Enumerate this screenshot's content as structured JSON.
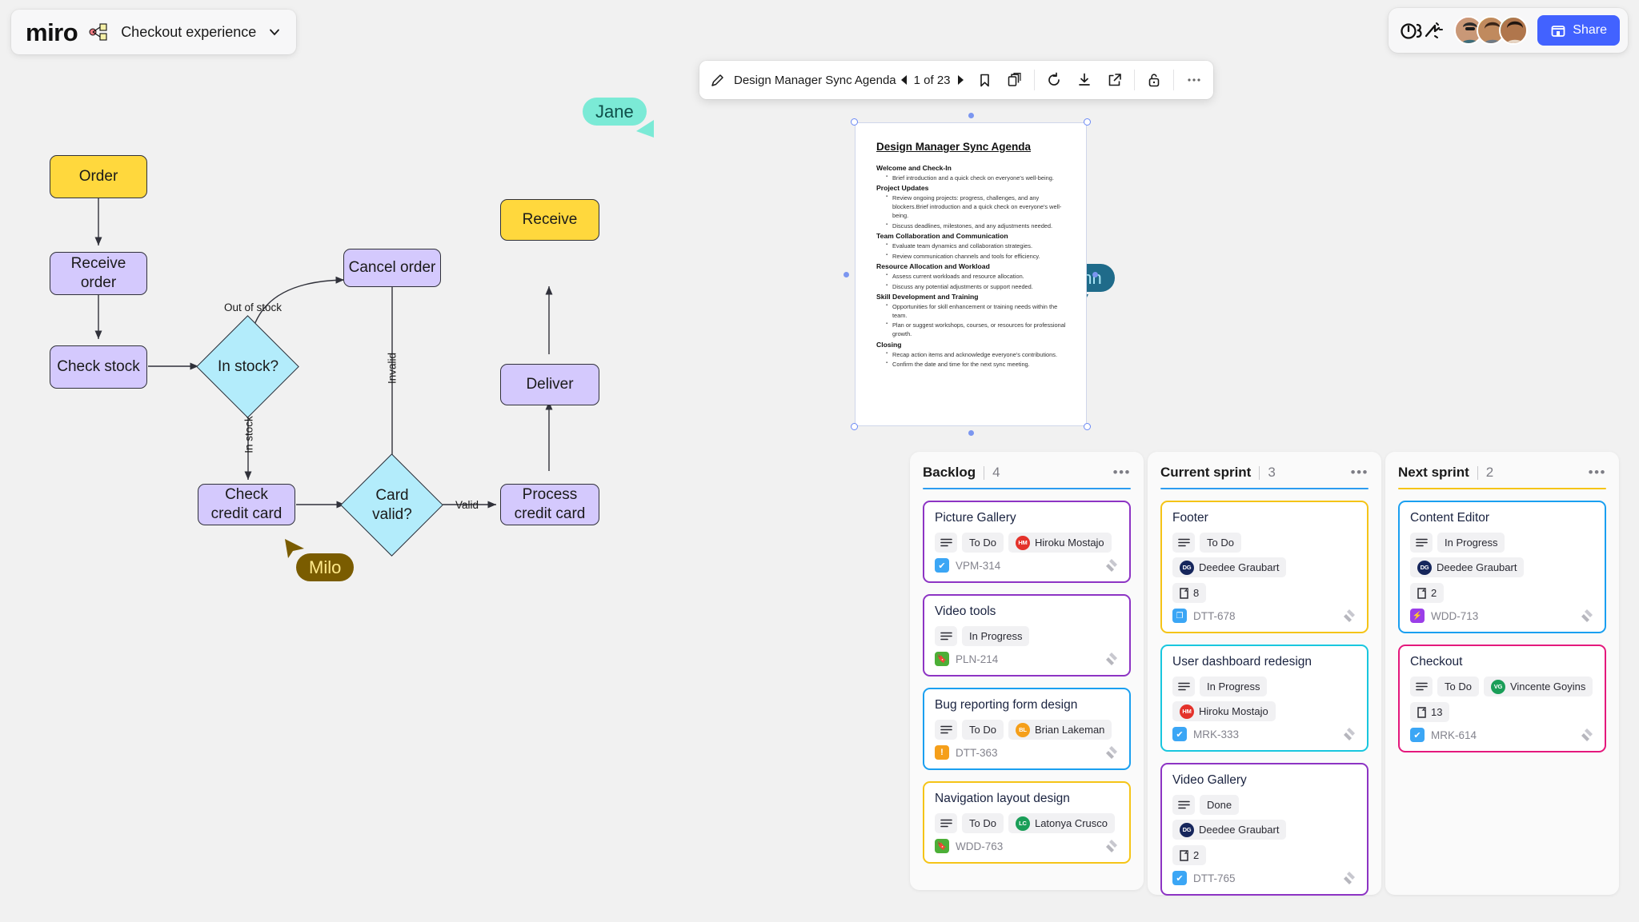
{
  "app": {
    "logo_text": "miro",
    "board_title": "Checkout experience",
    "board_icon": "board-thumbnail-icon",
    "chevron_icon": "chevron-down-icon"
  },
  "top_right": {
    "reactions_icon": "reactions-timer-icon",
    "share_label": "Share",
    "share_icon": "share-board-icon",
    "collaborators": [
      {
        "name": "collaborator-1",
        "ring_color": "#f07070",
        "skin": "#c99877",
        "hair": "#2b2b2b",
        "shirt": "#3d6d7a"
      },
      {
        "name": "collaborator-2",
        "ring_color": "#f2c31c",
        "skin": "#c08a5e",
        "hair": "#3a2518",
        "shirt": "#6f7a85"
      },
      {
        "name": "collaborator-3",
        "ring_color": "#4ec27a",
        "skin": "#b0764c",
        "hair": "#1f1510",
        "shirt": "#e8d7c6"
      }
    ]
  },
  "doc_toolbar": {
    "edit_icon": "pencil-icon",
    "doc_name": "Design Manager Sync Agenda",
    "prev_icon": "prev-page-icon",
    "pager": "1 of 23",
    "next_icon": "next-page-icon",
    "bookmark_icon": "bookmark-icon",
    "duplicate_icon": "duplicate-icon",
    "refresh_icon": "refresh-icon",
    "download_icon": "download-icon",
    "open_icon": "open-external-icon",
    "lock_icon": "unlock-icon",
    "more_icon": "more-options-icon"
  },
  "document": {
    "title": "Design Manager Sync Agenda",
    "sections": [
      {
        "heading": "Welcome and Check-In",
        "items": [
          "Brief introduction and a quick check on everyone's well-being."
        ]
      },
      {
        "heading": "Project Updates",
        "items": [
          "Review ongoing projects: progress, challenges, and any blockers.Brief introduction and a quick check on everyone's well-being.",
          "Discuss deadlines, milestones, and any adjustments needed."
        ]
      },
      {
        "heading": "Team Collaboration and Communication",
        "items": [
          "Evaluate team dynamics and collaboration strategies.",
          "Review communication channels and tools for efficiency."
        ]
      },
      {
        "heading": "Resource Allocation and Workload",
        "items": [
          "Assess current workloads and resource allocation.",
          "Discuss any potential adjustments or support needed."
        ]
      },
      {
        "heading": "Skill Development and Training",
        "items": [
          "Opportunities for skill enhancement or training needs within the team.",
          "Plan or suggest workshops, courses, or resources for professional growth."
        ]
      },
      {
        "heading": "Closing",
        "items": [
          "Recap action items and acknowledge everyone's contributions.",
          "Confirm the date and time for the next sync meeting."
        ]
      }
    ]
  },
  "flowchart": {
    "nodes": {
      "order": "Order",
      "receive_order": "Receive order",
      "check_stock": "Check stock",
      "in_stock": "In stock?",
      "cancel_order": "Cancel order",
      "check_credit_card": "Check\ncredit card",
      "card_valid": "Card\nvalid?",
      "process_credit_card": "Process\ncredit card",
      "deliver": "Deliver",
      "receive": "Receive"
    },
    "edge_labels": {
      "out_of_stock": "Out of stock",
      "in_stock": "In stock",
      "invalid": "Invalid",
      "valid": "Valid"
    },
    "colors": {
      "start_end": "#ffd83d",
      "process": "#d4c9fd",
      "decision": "#b3ecfb",
      "stroke": "#30313a"
    }
  },
  "cursors": [
    {
      "name": "Jane",
      "bg": "#7bead6",
      "text": "#0f4f4a",
      "pointer": "#7bead6"
    },
    {
      "name": "John",
      "bg": "#1f6b8a",
      "text": "#a9e5f5",
      "pointer": "#1f6b8a"
    },
    {
      "name": "Milo",
      "bg": "#7a5c00",
      "text": "#ffe98a",
      "pointer": "#7a5c00"
    }
  ],
  "kanban": {
    "columns": [
      {
        "title": "Backlog",
        "count": "4",
        "rule_color": "#2d9cf0",
        "more_icon": "more-options-icon",
        "cards": [
          {
            "title": "Picture Gallery",
            "border": "#8d34c4",
            "lines_icon": "description-lines-icon",
            "status": "To Do",
            "assignee": "Hiroku Mostajo",
            "initials": "HM",
            "avatar_color": "#e4322b",
            "points": null,
            "key": "VPM-314",
            "key_icon": "task-check-icon",
            "key_icon_color": "#3ba6f5",
            "key_icon_glyph": "✔"
          },
          {
            "title": "Video tools",
            "border": "#8d34c4",
            "lines_icon": "description-lines-icon",
            "status": "In Progress",
            "assignee": null,
            "initials": null,
            "avatar_color": null,
            "points": null,
            "key": "PLN-214",
            "key_icon": "story-bookmark-icon",
            "key_icon_color": "#4caf37",
            "key_icon_glyph": "🔖"
          },
          {
            "title": "Bug reporting form design",
            "border": "#1a9ff0",
            "lines_icon": "description-lines-icon",
            "status": "To Do",
            "assignee": "Brian Lakeman",
            "initials": "BL",
            "avatar_color": "#f59f1a",
            "points": null,
            "key": "DTT-363",
            "key_icon": "bug-alert-icon",
            "key_icon_color": "#f59f1a",
            "key_icon_glyph": "!"
          },
          {
            "title": "Navigation layout design",
            "border": "#f5c417",
            "lines_icon": "description-lines-icon",
            "status": "To Do",
            "assignee": "Latonya Crusco",
            "initials": "LC",
            "avatar_color": "#1a9e58",
            "points": null,
            "key": "WDD-763",
            "key_icon": "story-bookmark-icon",
            "key_icon_color": "#4caf37",
            "key_icon_glyph": "🔖"
          }
        ]
      },
      {
        "title": "Current sprint",
        "count": "3",
        "rule_color": "#2d9cf0",
        "more_icon": "more-options-icon",
        "cards": [
          {
            "title": "Footer",
            "border": "#f5c417",
            "lines_icon": "description-lines-icon",
            "status": "To Do",
            "assignee": "Deedee Graubart",
            "initials": "DG",
            "avatar_color": "#16265c",
            "points": "8",
            "points_icon": "story-points-icon",
            "key": "DTT-678",
            "key_icon": "copy-task-icon",
            "key_icon_color": "#3ba6f5",
            "key_icon_glyph": "❐"
          },
          {
            "title": "User dashboard redesign",
            "border": "#18c7df",
            "lines_icon": "description-lines-icon",
            "status": "In Progress",
            "assignee": "Hiroku Mostajo",
            "initials": "HM",
            "avatar_color": "#e4322b",
            "points": null,
            "key": "MRK-333",
            "key_icon": "task-check-icon",
            "key_icon_color": "#3ba6f5",
            "key_icon_glyph": "✔"
          },
          {
            "title": "Video Gallery",
            "border": "#8d34c4",
            "lines_icon": "description-lines-icon",
            "status": "Done",
            "assignee": "Deedee Graubart",
            "initials": "DG",
            "avatar_color": "#16265c",
            "points": "2",
            "points_icon": "story-points-icon",
            "key": "DTT-765",
            "key_icon": "task-check-icon",
            "key_icon_color": "#3ba6f5",
            "key_icon_glyph": "✔"
          }
        ]
      },
      {
        "title": "Next sprint",
        "count": "2",
        "rule_color": "#f5c417",
        "more_icon": "more-options-icon",
        "cards": [
          {
            "title": "Content Editor",
            "border": "#1a9ff0",
            "lines_icon": "description-lines-icon",
            "status": "In Progress",
            "assignee": "Deedee Graubart",
            "initials": "DG",
            "avatar_color": "#16265c",
            "points": "2",
            "points_icon": "story-points-icon",
            "key": "WDD-713",
            "key_icon": "epic-bolt-icon",
            "key_icon_color": "#9b3ee8",
            "key_icon_glyph": "⚡"
          },
          {
            "title": "Checkout",
            "border": "#e4187c",
            "lines_icon": "description-lines-icon",
            "status": "To Do",
            "assignee": "Vincente Goyins",
            "initials": "VG",
            "avatar_color": "#1a9e58",
            "points": "13",
            "points_icon": "story-points-icon",
            "key": "MRK-614",
            "key_icon": "task-check-icon",
            "key_icon_color": "#3ba6f5",
            "key_icon_glyph": "✔"
          }
        ]
      }
    ]
  }
}
